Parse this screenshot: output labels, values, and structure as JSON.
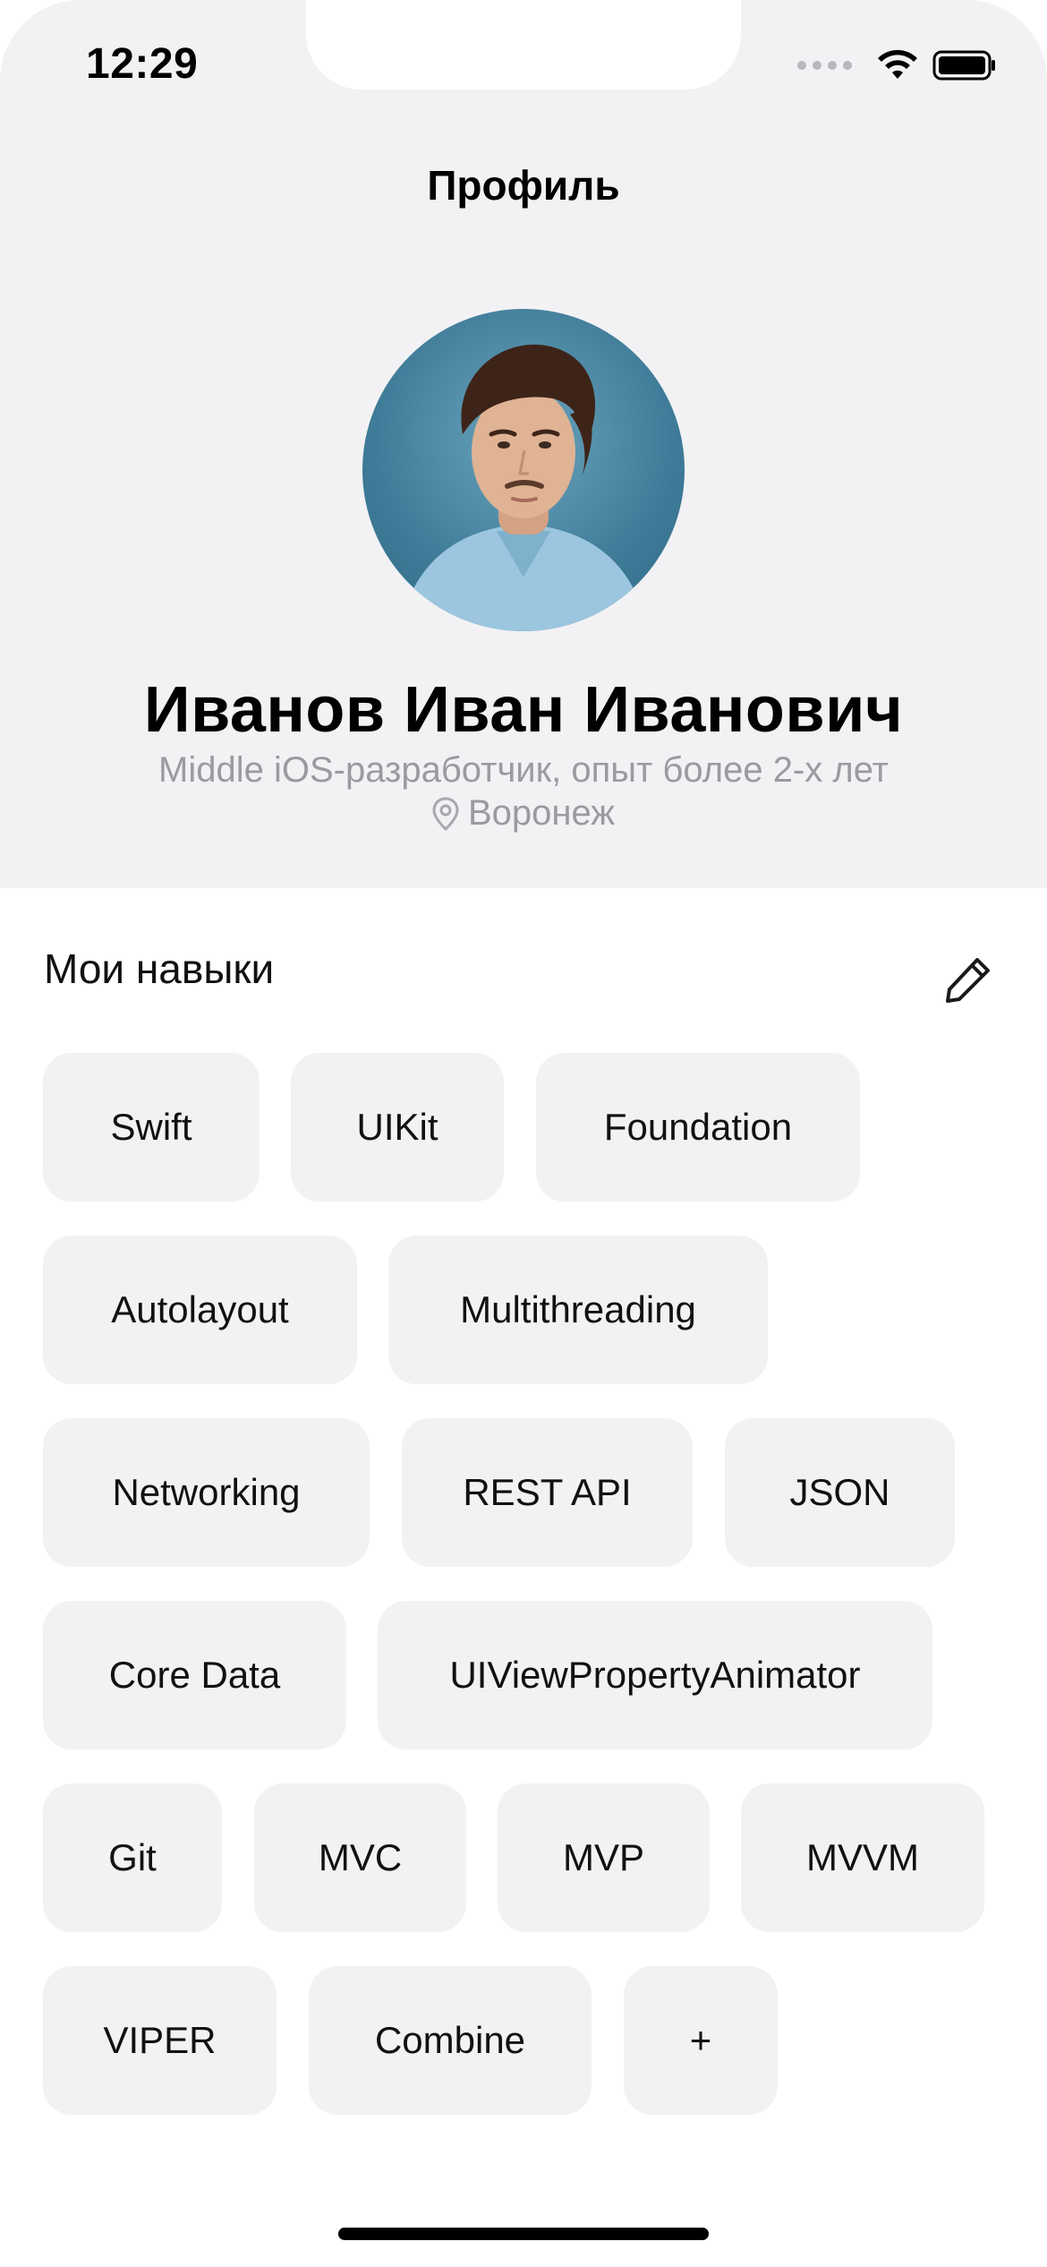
{
  "status_bar": {
    "time": "12:29"
  },
  "nav": {
    "title": "Профиль"
  },
  "profile": {
    "name": "Иванов Иван Иванович",
    "role": "Middle iOS-разработчик, опыт более 2-х лет",
    "city": "Воронеж"
  },
  "skills_section": {
    "title": "Мои навыки",
    "edit_icon": "pencil-icon"
  },
  "skills": [
    "Swift",
    "UIKit",
    "Foundation",
    "Autolayout",
    "Multithreading",
    "Networking",
    "REST API",
    "JSON",
    "Core Data",
    "UIViewPropertyAnimator",
    "Git",
    "MVC",
    "MVP",
    "MVVM",
    "VIPER",
    "Combine"
  ],
  "add_skill": {
    "label": "+"
  },
  "colors": {
    "header_background": "#f2f2f4",
    "chip_background": "#f2f2f4",
    "secondary_text": "#9b9b9f"
  }
}
